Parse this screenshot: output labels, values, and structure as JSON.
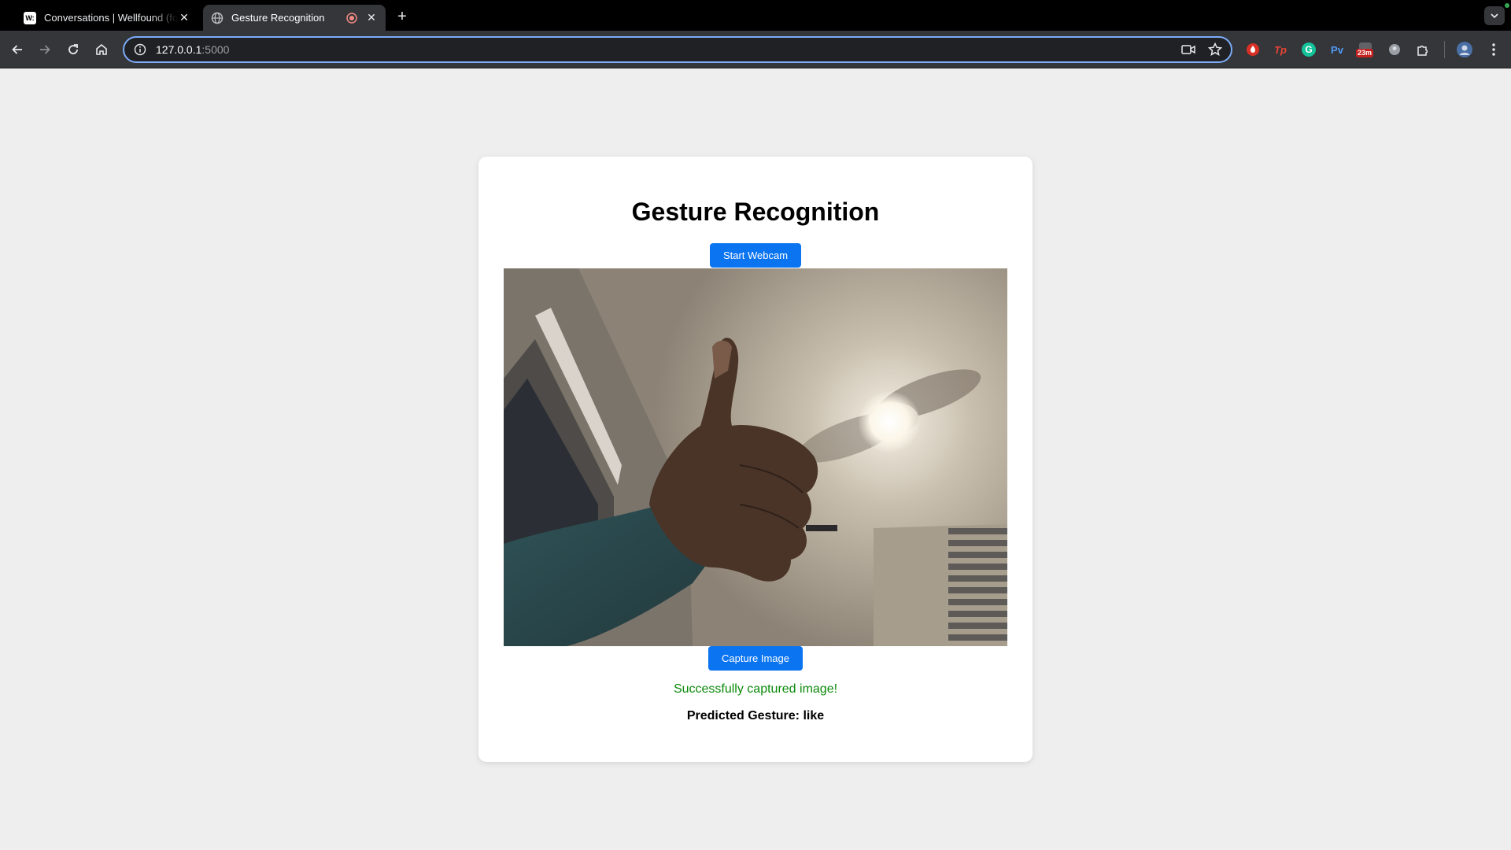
{
  "browser": {
    "tabs": [
      {
        "title": "Conversations | Wellfound (fo",
        "favicon": "W:",
        "active": false
      },
      {
        "title": "Gesture Recognition",
        "active": true
      }
    ],
    "url_host": "127.0.0.1",
    "url_port": ":5000",
    "extensions": [
      {
        "name": "extension-red-icon",
        "label": ""
      },
      {
        "name": "extension-tp-icon",
        "label": "Tp"
      },
      {
        "name": "grammarly-icon",
        "label": "G"
      },
      {
        "name": "extension-pv-icon",
        "label": "Pv"
      },
      {
        "name": "timer-extension-icon",
        "label": "23m"
      }
    ],
    "colors": {
      "accent": "#7cacf8",
      "chrome_bg": "#35363a"
    }
  },
  "page": {
    "title": "Gesture Recognition",
    "start_button": "Start Webcam",
    "capture_button": "Capture Image",
    "status_message": "Successfully captured image!",
    "prediction": "Predicted Gesture: like",
    "colors": {
      "button": "#0b74f0",
      "success": "#0a8a0a",
      "background": "#eeeeee"
    }
  }
}
